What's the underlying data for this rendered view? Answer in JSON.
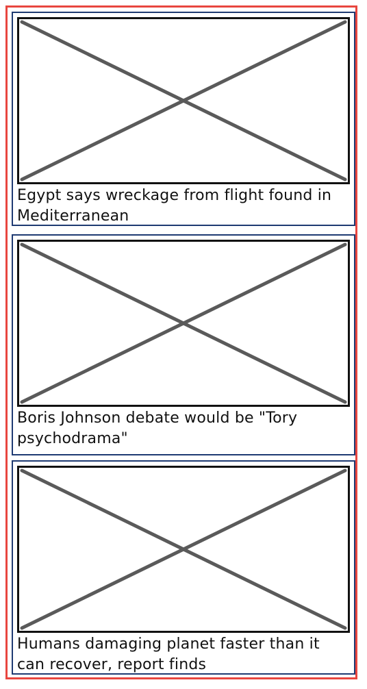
{
  "articles": [
    {
      "headline": "Egypt says wreckage from flight found in Mediterranean",
      "image_icon": "placeholder-image-icon"
    },
    {
      "headline": "Boris Johnson debate would be \"Tory psychodrama\"",
      "image_icon": "placeholder-image-icon"
    },
    {
      "headline": "Humans damaging planet faster than it can recover, report finds",
      "image_icon": "placeholder-image-icon"
    }
  ],
  "colors": {
    "outer_border": "#e8463f",
    "card_border": "#1e3a72",
    "placeholder_stroke": "#5a5a5a"
  }
}
